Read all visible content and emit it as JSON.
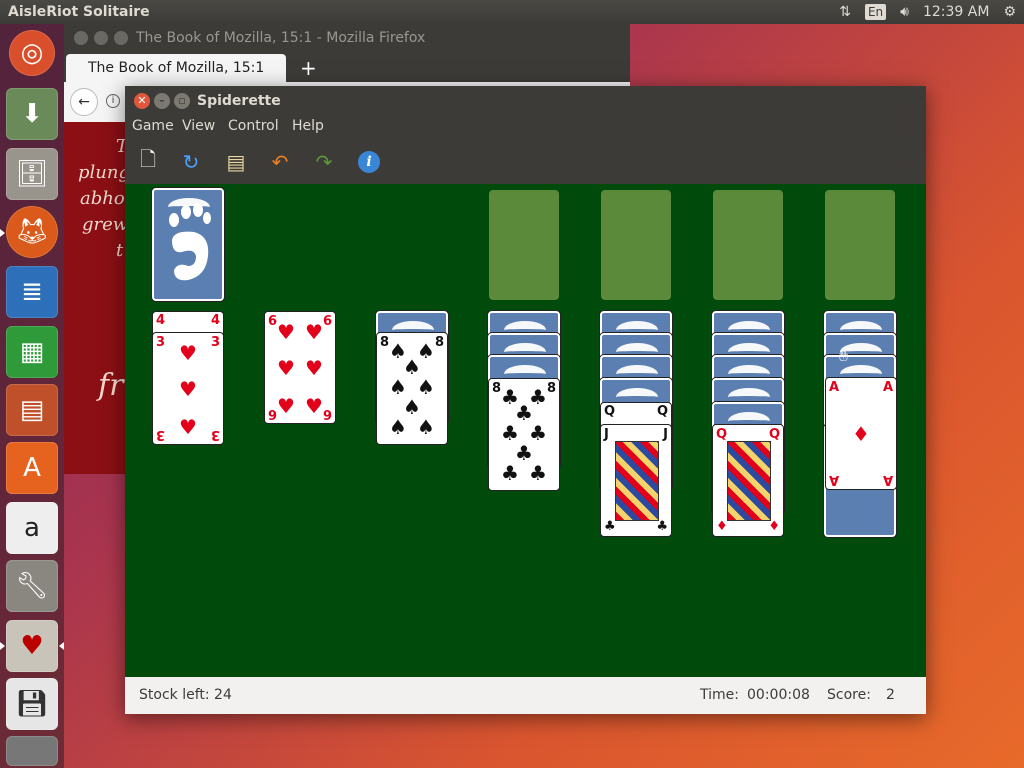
{
  "top_panel": {
    "app_title": "AisleRiot Solitaire",
    "lang": "En",
    "time": "12:39 AM",
    "icons": [
      "network-icon",
      "keyboard-icon",
      "volume-icon",
      "gear-icon"
    ]
  },
  "launcher": {
    "items": [
      "ubuntu-dash",
      "system-settings-installer",
      "files",
      "firefox",
      "libreoffice-writer",
      "libreoffice-calc",
      "libreoffice-impress",
      "ubuntu-software",
      "amazon",
      "system-tools",
      "aisleriot",
      "floppy-disk",
      "trash"
    ]
  },
  "firefox": {
    "window_title": "The Book of Mozilla, 15:1 - Mozilla Firefox",
    "tab_label": "The Book of Mozilla, 15:1",
    "new_tab": "+",
    "content_lines": [
      "T",
      "plung",
      "abho",
      "grew",
      "t"
    ],
    "content_big": "fr"
  },
  "spiderette": {
    "title": "Spiderette",
    "menu": [
      "Game",
      "View",
      "Control",
      "Help"
    ],
    "toolbar": [
      "new-game-icon",
      "restart-icon",
      "deal-icon",
      "undo-icon",
      "redo-icon",
      "info-icon"
    ],
    "status": {
      "stock_left": "Stock left: 24",
      "time_label": "Time:",
      "time_value": "00:00:08",
      "score_label": "Score:",
      "score_value": "2"
    },
    "tableau": {
      "col1": {
        "rank": "3",
        "suit": "♥",
        "under": "4"
      },
      "col2": {
        "rank": "6",
        "suit": "♥"
      },
      "col3": {
        "rank": "8",
        "suit": "♠"
      },
      "col4": {
        "rank": "8",
        "suit": "♣"
      },
      "col5": {
        "rank": "J",
        "suit": "♣",
        "under": "Q"
      },
      "col6": {
        "rank": "Q",
        "suit": "♦"
      },
      "col7": {
        "rank": "A",
        "suit": "♦"
      }
    }
  },
  "colors": {
    "felt": "#004a0c",
    "slot": "#5a8a3a",
    "card_back": "#5b7fb0",
    "red_suit": "#e2001a",
    "panel": "#3c3b37"
  }
}
